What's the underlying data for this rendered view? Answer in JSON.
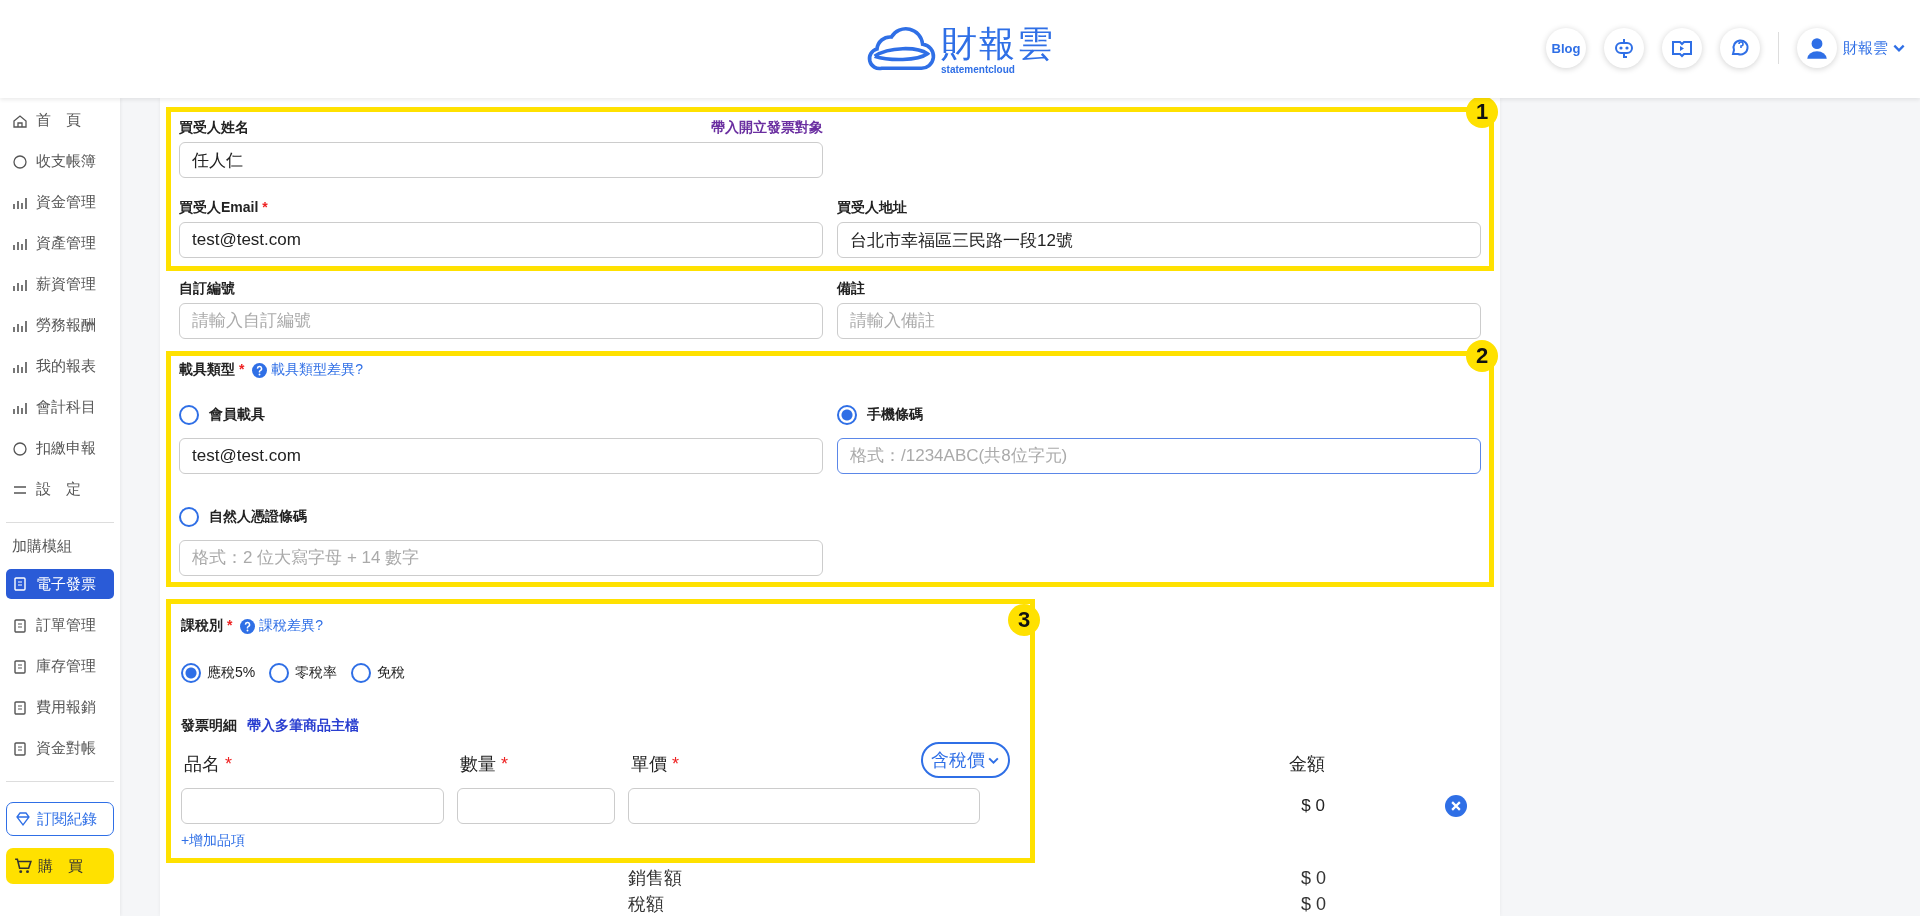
{
  "header": {
    "logo": {
      "name": "財報雲",
      "tagline": "statementcloud"
    },
    "buttons": [
      {
        "kind": "blog",
        "label": "Blog"
      },
      {
        "kind": "robot"
      },
      {
        "kind": "video"
      },
      {
        "kind": "help"
      }
    ],
    "user": {
      "name": "財報雲"
    }
  },
  "sidebar": {
    "items": [
      {
        "label": "首　頁",
        "selected": false
      },
      {
        "label": "收支帳簿",
        "selected": false
      },
      {
        "label": "資金管理",
        "selected": false
      },
      {
        "label": "資產管理",
        "selected": false
      },
      {
        "label": "薪資管理",
        "selected": false
      },
      {
        "label": "勞務報酬",
        "selected": false
      },
      {
        "label": "我的報表",
        "selected": false
      },
      {
        "label": "會計科目",
        "selected": false
      },
      {
        "label": "扣繳申報",
        "selected": false
      },
      {
        "label": "設　定",
        "selected": false
      }
    ],
    "section_title": "加購模組",
    "modules": [
      {
        "label": "電子發票",
        "selected": true
      },
      {
        "label": "訂單管理",
        "selected": false
      },
      {
        "label": "庫存管理",
        "selected": false
      },
      {
        "label": "費用報銷",
        "selected": false
      },
      {
        "label": "資金對帳",
        "selected": false
      }
    ],
    "subscription_button": "訂閱紀錄",
    "buy_button": "購　買"
  },
  "form": {
    "section_1": {
      "badge": "1",
      "buyer_name": {
        "label": "買受人姓名",
        "value": "任人仁"
      },
      "import_link": "帶入開立發票對象",
      "buyer_email": {
        "label": "買受人Email",
        "required_mark": "*",
        "value": "test@test.com"
      },
      "buyer_address": {
        "label": "買受人地址",
        "value": "台北市幸福區三民路一段12號"
      }
    },
    "custom_number": {
      "label": "自訂編號",
      "placeholder": "請輸入自訂編號"
    },
    "remarks": {
      "label": "備註",
      "placeholder": "請輸入備註"
    },
    "section_2": {
      "badge": "2",
      "label": "載具類型",
      "required_mark": "*",
      "help_link": "載具類型差異?",
      "options": [
        {
          "label": "會員載具",
          "selected": false,
          "value": "test@test.com",
          "focused": false
        },
        {
          "label": "手機條碼",
          "selected": true,
          "placeholder": "格式：/1234ABC(共8位字元)",
          "focused": true
        },
        {
          "label": "自然人憑證條碼",
          "selected": false,
          "placeholder": "格式：2 位大寫字母 + 14 數字",
          "focused": false
        }
      ]
    },
    "section_3": {
      "badge": "3",
      "label": "課稅別",
      "required_mark": "*",
      "help_link": "課稅差異?",
      "tax_options": [
        {
          "label": "應稅5%",
          "selected": true
        },
        {
          "label": "零稅率",
          "selected": false
        },
        {
          "label": "免稅",
          "selected": false
        }
      ],
      "details_label": "發票明細",
      "details_link": "帶入多筆商品主檔",
      "columns": [
        {
          "label": "品名",
          "required_mark": "*"
        },
        {
          "label": "數量",
          "required_mark": "*"
        },
        {
          "label": "單價",
          "required_mark": "*"
        },
        {
          "label": "金額"
        }
      ],
      "price_mode": "含稅價",
      "items": [
        {
          "amount": "$ 0"
        }
      ],
      "add_item": "+增加品項"
    },
    "totals": [
      {
        "label": "銷售額",
        "value": "$ 0"
      },
      {
        "label": "稅額",
        "value": "$ 0"
      }
    ]
  }
}
